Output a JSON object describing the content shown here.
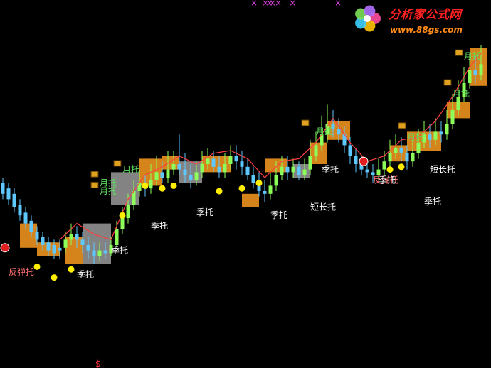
{
  "chart_data": {
    "type": "candlestick",
    "y_range": [
      0,
      100
    ],
    "candles": [
      {
        "x": 0,
        "o": 48,
        "c": 44,
        "h": 50,
        "l": 42
      },
      {
        "x": 1,
        "o": 46,
        "c": 42,
        "h": 48,
        "l": 40
      },
      {
        "x": 2,
        "o": 44,
        "c": 39,
        "h": 46,
        "l": 37
      },
      {
        "x": 3,
        "o": 40,
        "c": 36,
        "h": 42,
        "l": 34
      },
      {
        "x": 4,
        "o": 37,
        "c": 33,
        "h": 39,
        "l": 31
      },
      {
        "x": 5,
        "o": 34,
        "c": 30,
        "h": 36,
        "l": 28
      },
      {
        "x": 6,
        "o": 30,
        "c": 27,
        "h": 32,
        "l": 25
      },
      {
        "x": 7,
        "o": 28,
        "c": 25,
        "h": 30,
        "l": 23
      },
      {
        "x": 8,
        "o": 26,
        "c": 23,
        "h": 28,
        "l": 21
      },
      {
        "x": 9,
        "o": 25,
        "c": 22,
        "h": 27,
        "l": 20
      },
      {
        "x": 10,
        "o": 24,
        "c": 23,
        "h": 27,
        "l": 20
      },
      {
        "x": 11,
        "o": 24,
        "c": 27,
        "h": 30,
        "l": 22
      },
      {
        "x": 12,
        "o": 27,
        "c": 29,
        "h": 33,
        "l": 25
      },
      {
        "x": 13,
        "o": 29,
        "c": 27,
        "h": 32,
        "l": 24
      },
      {
        "x": 14,
        "o": 27,
        "c": 25,
        "h": 30,
        "l": 22
      },
      {
        "x": 15,
        "o": 25,
        "c": 23,
        "h": 28,
        "l": 20
      },
      {
        "x": 16,
        "o": 23,
        "c": 21,
        "h": 26,
        "l": 18
      },
      {
        "x": 17,
        "o": 21,
        "c": 23,
        "h": 26,
        "l": 19
      },
      {
        "x": 18,
        "o": 23,
        "c": 22,
        "h": 26,
        "l": 20
      },
      {
        "x": 19,
        "o": 22,
        "c": 25,
        "h": 28,
        "l": 21
      },
      {
        "x": 20,
        "o": 25,
        "c": 31,
        "h": 34,
        "l": 24
      },
      {
        "x": 21,
        "o": 31,
        "c": 35,
        "h": 39,
        "l": 29
      },
      {
        "x": 22,
        "o": 35,
        "c": 40,
        "h": 44,
        "l": 33
      },
      {
        "x": 23,
        "o": 40,
        "c": 45,
        "h": 49,
        "l": 38
      },
      {
        "x": 24,
        "o": 45,
        "c": 48,
        "h": 53,
        "l": 43
      },
      {
        "x": 25,
        "o": 48,
        "c": 46,
        "h": 51,
        "l": 43
      },
      {
        "x": 26,
        "o": 46,
        "c": 49,
        "h": 55,
        "l": 44
      },
      {
        "x": 27,
        "o": 49,
        "c": 52,
        "h": 58,
        "l": 47
      },
      {
        "x": 28,
        "o": 52,
        "c": 50,
        "h": 56,
        "l": 48
      },
      {
        "x": 29,
        "o": 50,
        "c": 53,
        "h": 60,
        "l": 48
      },
      {
        "x": 30,
        "o": 53,
        "c": 55,
        "h": 60,
        "l": 51
      },
      {
        "x": 31,
        "o": 55,
        "c": 53,
        "h": 66,
        "l": 51
      },
      {
        "x": 32,
        "o": 53,
        "c": 51,
        "h": 59,
        "l": 48
      },
      {
        "x": 33,
        "o": 51,
        "c": 49,
        "h": 55,
        "l": 46
      },
      {
        "x": 34,
        "o": 49,
        "c": 52,
        "h": 56,
        "l": 47
      },
      {
        "x": 35,
        "o": 52,
        "c": 55,
        "h": 60,
        "l": 50
      },
      {
        "x": 36,
        "o": 55,
        "c": 57,
        "h": 61,
        "l": 53
      },
      {
        "x": 37,
        "o": 57,
        "c": 54,
        "h": 60,
        "l": 52
      },
      {
        "x": 38,
        "o": 54,
        "c": 52,
        "h": 58,
        "l": 50
      },
      {
        "x": 39,
        "o": 52,
        "c": 55,
        "h": 59,
        "l": 50
      },
      {
        "x": 40,
        "o": 55,
        "c": 58,
        "h": 62,
        "l": 53
      },
      {
        "x": 41,
        "o": 58,
        "c": 56,
        "h": 62,
        "l": 53
      },
      {
        "x": 42,
        "o": 56,
        "c": 54,
        "h": 60,
        "l": 51
      },
      {
        "x": 43,
        "o": 54,
        "c": 51,
        "h": 57,
        "l": 49
      },
      {
        "x": 44,
        "o": 51,
        "c": 48,
        "h": 54,
        "l": 46
      },
      {
        "x": 45,
        "o": 48,
        "c": 45,
        "h": 52,
        "l": 43
      },
      {
        "x": 46,
        "o": 45,
        "c": 44,
        "h": 49,
        "l": 41
      },
      {
        "x": 47,
        "o": 44,
        "c": 47,
        "h": 52,
        "l": 42
      },
      {
        "x": 48,
        "o": 47,
        "c": 51,
        "h": 56,
        "l": 45
      },
      {
        "x": 49,
        "o": 51,
        "c": 54,
        "h": 58,
        "l": 49
      },
      {
        "x": 50,
        "o": 54,
        "c": 52,
        "h": 58,
        "l": 49
      },
      {
        "x": 51,
        "o": 52,
        "c": 54,
        "h": 57,
        "l": 50
      },
      {
        "x": 52,
        "o": 54,
        "c": 51,
        "h": 56,
        "l": 49
      },
      {
        "x": 53,
        "o": 51,
        "c": 53,
        "h": 57,
        "l": 49
      },
      {
        "x": 54,
        "o": 53,
        "c": 58,
        "h": 64,
        "l": 51
      },
      {
        "x": 55,
        "o": 58,
        "c": 62,
        "h": 67,
        "l": 56
      },
      {
        "x": 56,
        "o": 62,
        "c": 66,
        "h": 73,
        "l": 60
      },
      {
        "x": 57,
        "o": 66,
        "c": 70,
        "h": 77,
        "l": 63
      },
      {
        "x": 58,
        "o": 70,
        "c": 68,
        "h": 75,
        "l": 65
      },
      {
        "x": 59,
        "o": 68,
        "c": 66,
        "h": 72,
        "l": 63
      },
      {
        "x": 60,
        "o": 66,
        "c": 62,
        "h": 69,
        "l": 59
      },
      {
        "x": 61,
        "o": 62,
        "c": 58,
        "h": 65,
        "l": 55
      },
      {
        "x": 62,
        "o": 58,
        "c": 55,
        "h": 61,
        "l": 52
      },
      {
        "x": 63,
        "o": 55,
        "c": 53,
        "h": 58,
        "l": 51
      },
      {
        "x": 64,
        "o": 53,
        "c": 52,
        "h": 56,
        "l": 50
      },
      {
        "x": 65,
        "o": 52,
        "c": 51,
        "h": 55,
        "l": 48
      },
      {
        "x": 66,
        "o": 51,
        "c": 53,
        "h": 57,
        "l": 49
      },
      {
        "x": 67,
        "o": 53,
        "c": 56,
        "h": 60,
        "l": 51
      },
      {
        "x": 68,
        "o": 56,
        "c": 59,
        "h": 64,
        "l": 54
      },
      {
        "x": 69,
        "o": 59,
        "c": 61,
        "h": 66,
        "l": 57
      },
      {
        "x": 70,
        "o": 61,
        "c": 59,
        "h": 65,
        "l": 56
      },
      {
        "x": 71,
        "o": 59,
        "c": 56,
        "h": 62,
        "l": 53
      },
      {
        "x": 72,
        "o": 56,
        "c": 59,
        "h": 64,
        "l": 54
      },
      {
        "x": 73,
        "o": 59,
        "c": 63,
        "h": 68,
        "l": 57
      },
      {
        "x": 74,
        "o": 63,
        "c": 66,
        "h": 71,
        "l": 61
      },
      {
        "x": 75,
        "o": 66,
        "c": 64,
        "h": 70,
        "l": 61
      },
      {
        "x": 76,
        "o": 64,
        "c": 67,
        "h": 72,
        "l": 62
      },
      {
        "x": 77,
        "o": 67,
        "c": 66,
        "h": 71,
        "l": 63
      },
      {
        "x": 78,
        "o": 66,
        "c": 70,
        "h": 75,
        "l": 64
      },
      {
        "x": 79,
        "o": 70,
        "c": 75,
        "h": 81,
        "l": 68
      },
      {
        "x": 80,
        "o": 75,
        "c": 80,
        "h": 86,
        "l": 73
      },
      {
        "x": 81,
        "o": 80,
        "c": 85,
        "h": 91,
        "l": 78
      },
      {
        "x": 82,
        "o": 85,
        "c": 90,
        "h": 96,
        "l": 83
      },
      {
        "x": 83,
        "o": 90,
        "c": 88,
        "h": 95,
        "l": 85
      },
      {
        "x": 84,
        "o": 88,
        "c": 92,
        "h": 99,
        "l": 86
      }
    ],
    "red_line": [
      {
        "x": 10,
        "y": 27
      },
      {
        "x": 13,
        "y": 33
      },
      {
        "x": 16,
        "y": 29
      },
      {
        "x": 19,
        "y": 27
      },
      {
        "x": 22,
        "y": 42
      },
      {
        "x": 25,
        "y": 51
      },
      {
        "x": 28,
        "y": 54
      },
      {
        "x": 31,
        "y": 58
      },
      {
        "x": 34,
        "y": 55
      },
      {
        "x": 37,
        "y": 59
      },
      {
        "x": 40,
        "y": 60
      },
      {
        "x": 43,
        "y": 57
      },
      {
        "x": 46,
        "y": 50
      },
      {
        "x": 49,
        "y": 56
      },
      {
        "x": 52,
        "y": 57
      },
      {
        "x": 55,
        "y": 63
      },
      {
        "x": 58,
        "y": 72
      },
      {
        "x": 61,
        "y": 63
      },
      {
        "x": 64,
        "y": 56
      },
      {
        "x": 67,
        "y": 58
      },
      {
        "x": 70,
        "y": 64
      },
      {
        "x": 73,
        "y": 65
      },
      {
        "x": 76,
        "y": 71
      },
      {
        "x": 79,
        "y": 80
      },
      {
        "x": 82,
        "y": 91
      },
      {
        "x": 84,
        "y": 96
      }
    ],
    "boxes": [
      {
        "x0": 3,
        "x1": 6,
        "top": 33,
        "bot": 24,
        "color": "orange"
      },
      {
        "x0": 6,
        "x1": 10,
        "top": 26,
        "bot": 21,
        "color": "orange"
      },
      {
        "x0": 11,
        "x1": 14,
        "top": 28,
        "bot": 18,
        "color": "orange"
      },
      {
        "x0": 14,
        "x1": 19,
        "top": 33,
        "bot": 18,
        "color": "gray"
      },
      {
        "x0": 19,
        "x1": 24,
        "top": 52,
        "bot": 40,
        "color": "gray"
      },
      {
        "x0": 24,
        "x1": 28,
        "top": 57,
        "bot": 47,
        "color": "orange"
      },
      {
        "x0": 28,
        "x1": 31,
        "top": 58,
        "bot": 53,
        "color": "orange"
      },
      {
        "x0": 31,
        "x1": 35,
        "top": 56,
        "bot": 48,
        "color": "gray"
      },
      {
        "x0": 35,
        "x1": 40,
        "top": 58,
        "bot": 52,
        "color": "orange"
      },
      {
        "x0": 42,
        "x1": 45,
        "top": 44,
        "bot": 39,
        "color": "orange"
      },
      {
        "x0": 46,
        "x1": 50,
        "top": 57,
        "bot": 52,
        "color": "orange"
      },
      {
        "x0": 51,
        "x1": 54,
        "top": 55,
        "bot": 50,
        "color": "gray"
      },
      {
        "x0": 54,
        "x1": 57,
        "top": 63,
        "bot": 55,
        "color": "orange"
      },
      {
        "x0": 57,
        "x1": 61,
        "top": 71,
        "bot": 64,
        "color": "orange"
      },
      {
        "x0": 68,
        "x1": 71,
        "top": 62,
        "bot": 56,
        "color": "orange"
      },
      {
        "x0": 71,
        "x1": 77,
        "top": 67,
        "bot": 60,
        "color": "orange"
      },
      {
        "x0": 78,
        "x1": 82,
        "top": 78,
        "bot": 72,
        "color": "orange"
      },
      {
        "x0": 82,
        "x1": 85,
        "top": 98,
        "bot": 84,
        "color": "orange"
      }
    ],
    "dots": [
      {
        "x": 6,
        "y": 17
      },
      {
        "x": 9,
        "y": 13
      },
      {
        "x": 12,
        "y": 16
      },
      {
        "x": 21,
        "y": 36
      },
      {
        "x": 25,
        "y": 47
      },
      {
        "x": 28,
        "y": 46
      },
      {
        "x": 30,
        "y": 47
      },
      {
        "x": 38,
        "y": 45
      },
      {
        "x": 42,
        "y": 46
      },
      {
        "x": 45,
        "y": 48
      },
      {
        "x": 68,
        "y": 53
      },
      {
        "x": 70,
        "y": 54
      }
    ],
    "icons": [
      {
        "x": 0,
        "y": 24,
        "kind": "red-ball"
      },
      {
        "x": 63,
        "y": 56,
        "kind": "red-ball"
      },
      {
        "x": 16,
        "y": 51,
        "kind": "box"
      },
      {
        "x": 16,
        "y": 47,
        "kind": "box"
      },
      {
        "x": 20,
        "y": 55,
        "kind": "box"
      },
      {
        "x": 53,
        "y": 70,
        "kind": "box"
      },
      {
        "x": 70,
        "y": 69,
        "kind": "box"
      },
      {
        "x": 78,
        "y": 85,
        "kind": "box"
      },
      {
        "x": 80,
        "y": 96,
        "kind": "box"
      }
    ],
    "signals": [
      {
        "x": 1,
        "y": 14,
        "text": "反弹托",
        "color": "#ff6e6e"
      },
      {
        "x": 13,
        "y": 13,
        "text": "季托",
        "color": "#ffffff"
      },
      {
        "x": 19,
        "y": 22,
        "text": "季托",
        "color": "#ffffff"
      },
      {
        "x": 26,
        "y": 31,
        "text": "季托",
        "color": "#ffffff"
      },
      {
        "x": 34,
        "y": 36,
        "text": "季托",
        "color": "#ffffff"
      },
      {
        "x": 47,
        "y": 35,
        "text": "季托",
        "color": "#ffffff"
      },
      {
        "x": 54,
        "y": 38,
        "text": "短长托",
        "color": "#ffffff"
      },
      {
        "x": 56,
        "y": 52,
        "text": "季托",
        "color": "#ffffff"
      },
      {
        "x": 65,
        "y": 48,
        "text": "反弹托",
        "color": "#ff6e6e"
      },
      {
        "x": 66,
        "y": 48,
        "text": "季托",
        "color": "#ffffff"
      },
      {
        "x": 75,
        "y": 52,
        "text": "短长托",
        "color": "#ffffff"
      },
      {
        "x": 74,
        "y": 40,
        "text": "季托",
        "color": "#ffffff"
      },
      {
        "x": 17,
        "y": 44,
        "text": "月托",
        "color": "#5ee05e"
      },
      {
        "x": 17,
        "y": 47,
        "text": "月托",
        "color": "#5ee05e"
      },
      {
        "x": 21,
        "y": 52,
        "text": "月托",
        "color": "#5ee05e"
      },
      {
        "x": 55,
        "y": 66,
        "text": "月托",
        "color": "#5ee05e"
      },
      {
        "x": 71,
        "y": 64,
        "text": "月托",
        "color": "#5ee05e"
      },
      {
        "x": 79,
        "y": 80,
        "text": "月托",
        "color": "#5ee05e"
      },
      {
        "x": 81,
        "y": 94,
        "text": "月托",
        "color": "#5ee05e"
      }
    ],
    "top_markers": [
      "×",
      "××",
      "×",
      "×",
      "×",
      "×"
    ],
    "bottom_marker": "$"
  },
  "watermark": {
    "title": "分析家公式网",
    "url": "www.88gs.com"
  },
  "colors": {
    "background": "#000000",
    "up": "#8cff5a",
    "down": "#5ec8ff",
    "box_orange": "#e08a1c",
    "box_gray": "#8a8a8a",
    "dot": "#ffee00",
    "trend": "#ff4040"
  }
}
